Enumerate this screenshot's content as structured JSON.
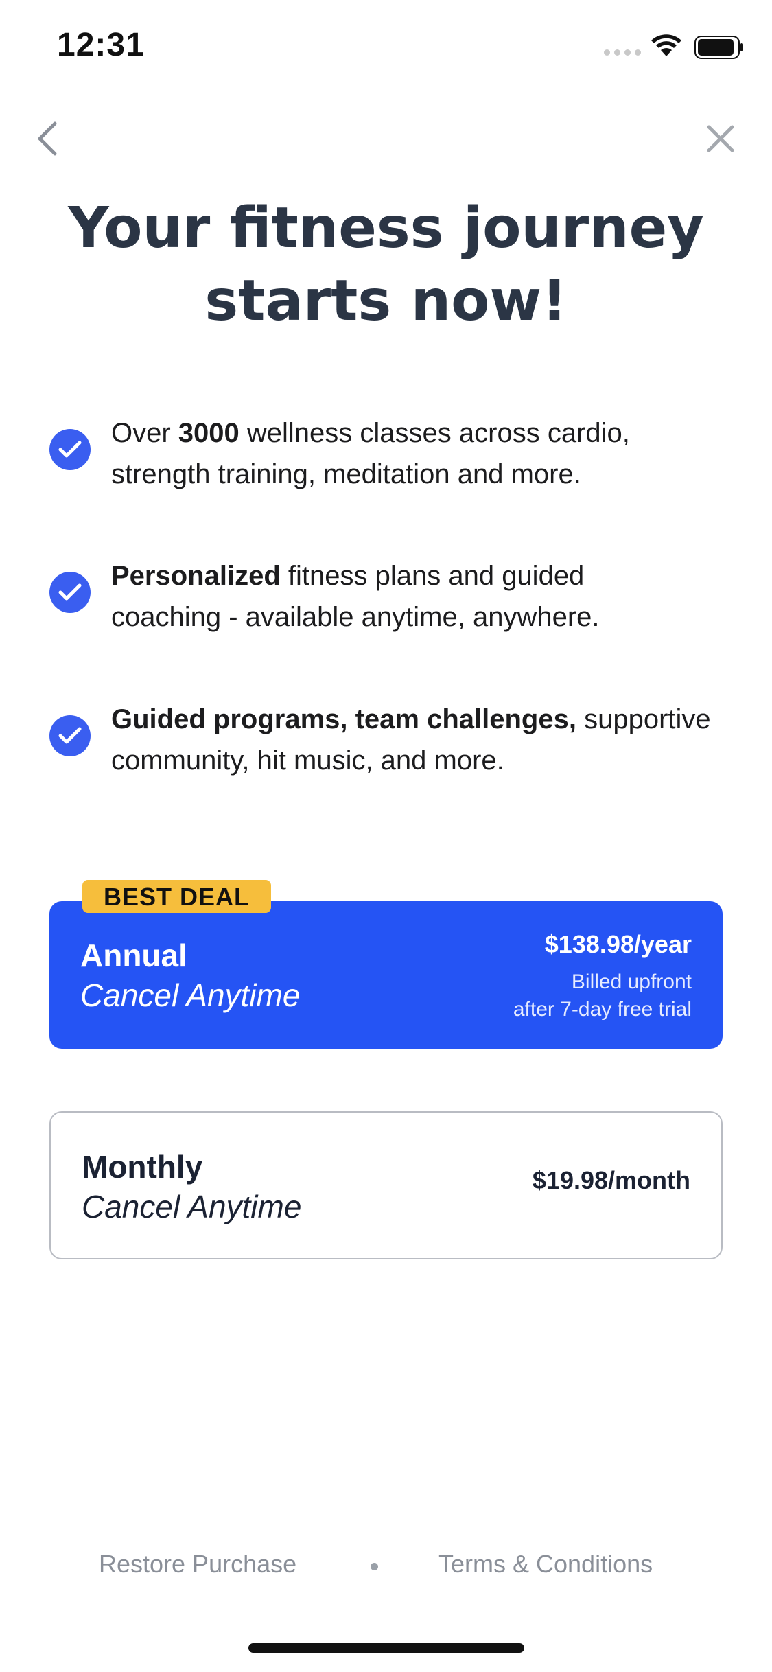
{
  "status_bar": {
    "time": "12:31"
  },
  "nav": {
    "back_icon": "chevron-left-icon",
    "close_icon": "close-icon"
  },
  "headline": {
    "line1": "Your fitness journey",
    "line2": "starts now!"
  },
  "features": [
    {
      "pre": "Over ",
      "bold": "3000",
      "post": " wellness classes across cardio, strength training, meditation and more."
    },
    {
      "pre": "",
      "bold": "Personalized",
      "post": " fitness plans and guided coaching - available anytime, anywhere."
    },
    {
      "pre": "",
      "bold": "Guided programs, team challenges,",
      "post": " supportive community, hit music, and more."
    }
  ],
  "plans": {
    "badge": "BEST DEAL",
    "annual": {
      "title": "Annual",
      "subtitle": "Cancel Anytime",
      "price": "$138.98/year",
      "note_line1": "Billed upfront",
      "note_line2": "after 7-day free trial"
    },
    "monthly": {
      "title": "Monthly",
      "subtitle": "Cancel Anytime",
      "price": "$19.98/month"
    }
  },
  "footer": {
    "restore": "Restore Purchase",
    "terms": "Terms & Conditions"
  },
  "colors": {
    "accent": "#2554f4",
    "check": "#3a5ef0",
    "badge": "#f6be3c",
    "headline": "#2b3545",
    "footer_text": "#8a8f98"
  }
}
